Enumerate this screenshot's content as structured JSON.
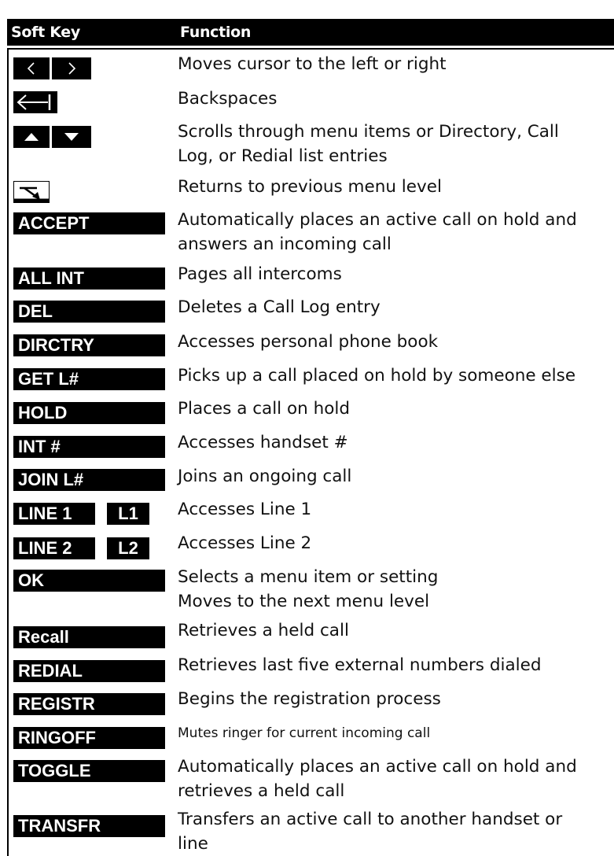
{
  "header": {
    "col_soft_key": "Soft Key",
    "col_function": "Function"
  },
  "rows": [
    {
      "keys": [
        "cursor-left-icon",
        "cursor-right-icon"
      ],
      "desc": [
        "Moves cursor to the left or right"
      ]
    },
    {
      "keys": [
        "backspace-icon"
      ],
      "desc": [
        "Backspaces"
      ]
    },
    {
      "keys": [
        "scroll-up-icon",
        "scroll-down-icon"
      ],
      "desc": [
        "Scrolls through menu items or Directory, Call",
        "Log, or Redial list entries"
      ]
    },
    {
      "keys": [
        "back-arrow-icon"
      ],
      "desc": [
        "Returns to previous menu level"
      ]
    },
    {
      "key_label": "ACCEPT",
      "desc": [
        "Automatically places an active call on hold and",
        "answers an incoming call"
      ]
    },
    {
      "key_label": "ALL INT",
      "desc": [
        "Pages all intercoms"
      ]
    },
    {
      "key_label": "DEL",
      "desc": [
        "Deletes a Call Log entry"
      ]
    },
    {
      "key_label": "DIRCTRY",
      "desc": [
        "Accesses personal phone book"
      ]
    },
    {
      "key_label": "GET L#",
      "desc": [
        "Picks up a call placed on hold by someone else"
      ]
    },
    {
      "key_label": "HOLD",
      "desc": [
        "Places a call on hold"
      ]
    },
    {
      "key_label": "INT #",
      "desc": [
        "Accesses handset #"
      ]
    },
    {
      "key_label": "JOIN L#",
      "desc": [
        "Joins an ongoing call"
      ]
    },
    {
      "key_label": "LINE 1",
      "key_label_2": "L1",
      "desc": [
        "Accesses Line 1"
      ]
    },
    {
      "key_label": "LINE 2",
      "key_label_2": "L2",
      "desc": [
        "Accesses Line 2"
      ]
    },
    {
      "key_label": "OK",
      "desc": [
        "Selects a menu item or setting",
        "Moves to the next menu level"
      ]
    },
    {
      "key_label": "Recall",
      "desc": [
        "Retrieves a held call"
      ]
    },
    {
      "key_label": "REDIAL",
      "desc": [
        "Retrieves last five external numbers dialed"
      ]
    },
    {
      "key_label": "REGISTR",
      "desc": [
        "Begins the registration process"
      ]
    },
    {
      "key_label": "RINGOFF",
      "desc": [
        "Mutes ringer for current incoming call"
      ]
    },
    {
      "key_label": "TOGGLE",
      "desc": [
        "Automatically places an active call on hold and",
        "retrieves a held call"
      ]
    },
    {
      "key_label": "TRANSFR",
      "desc": [
        "Transfers an active call to another handset or",
        "line"
      ]
    }
  ]
}
